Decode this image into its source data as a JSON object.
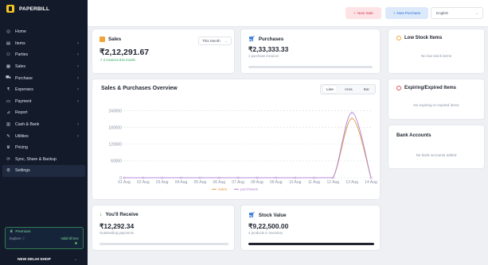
{
  "app": {
    "name": "PAPERBILL"
  },
  "sidebar": {
    "items": [
      {
        "label": "Home",
        "icon": "home-icon",
        "glyph": "◎",
        "chevron": false
      },
      {
        "label": "Items",
        "icon": "items-icon",
        "glyph": "▤",
        "chevron": true
      },
      {
        "label": "Parties",
        "icon": "users-icon",
        "glyph": "⚇",
        "chevron": true
      },
      {
        "label": "Sales",
        "icon": "sales-icon",
        "glyph": "▦",
        "chevron": true
      },
      {
        "label": "Purchase",
        "icon": "cart-icon",
        "glyph": "⛟",
        "chevron": true
      },
      {
        "label": "Expenses",
        "icon": "expenses-icon",
        "glyph": "₹",
        "chevron": true
      },
      {
        "label": "Payment",
        "icon": "payment-icon",
        "glyph": "▭",
        "chevron": true
      },
      {
        "label": "Report",
        "icon": "report-icon",
        "glyph": "⊿",
        "chevron": false
      },
      {
        "label": "Cash & Bank",
        "icon": "bank-icon",
        "glyph": "▥",
        "chevron": true
      },
      {
        "label": "Utilities",
        "icon": "utilities-icon",
        "glyph": "✎",
        "chevron": true
      },
      {
        "label": "Pricing",
        "icon": "pricing-icon",
        "glyph": "♛",
        "chevron": false
      },
      {
        "label": "Sync, Share & Backup",
        "icon": "sync-icon",
        "glyph": "⟳",
        "chevron": false
      },
      {
        "label": "Settings",
        "icon": "gear-icon",
        "glyph": "⚙",
        "chevron": false,
        "active": true
      }
    ],
    "premium": {
      "title": "Premium",
      "plan": "Explore ⓘ",
      "status": "Valid till Dec"
    },
    "shop": {
      "name": "NEW DELHI SHOP"
    }
  },
  "topbar": {
    "new_sale": "New Sale",
    "new_purchase": "New Purchase",
    "language": "English"
  },
  "sales": {
    "title": "Sales",
    "period": "This Month",
    "amount": "₹2,12,291.67",
    "trend": "2 invoices this month"
  },
  "purchases": {
    "title": "Purchases",
    "amount": "₹2,33,333.33",
    "sub": "1 purchase invoices"
  },
  "overview": {
    "title": "Sales & Purchases Overview",
    "toggles": [
      "Line",
      "Area",
      "Bar"
    ],
    "active_toggle": "Line"
  },
  "chart_data": {
    "type": "line",
    "title": "Sales & Purchases Overview",
    "x": [
      "01 Aug",
      "02 Aug",
      "03 Aug",
      "04 Aug",
      "05 Aug",
      "06 Aug",
      "07 Aug",
      "08 Aug",
      "09 Aug",
      "10 Aug",
      "11 Aug",
      "12 Aug",
      "13 Aug",
      "14 Aug"
    ],
    "yticks": [
      0,
      60000,
      120000,
      180000,
      240000
    ],
    "ylim": [
      0,
      250000
    ],
    "series": [
      {
        "name": "sales",
        "color": "#e3a14a",
        "values": [
          0,
          0,
          0,
          0,
          0,
          0,
          0,
          0,
          0,
          0,
          0,
          0,
          212292,
          0
        ]
      },
      {
        "name": "purchases",
        "color": "#b48ad8",
        "values": [
          0,
          0,
          0,
          0,
          0,
          0,
          0,
          0,
          0,
          0,
          0,
          0,
          233333,
          0
        ]
      }
    ],
    "grid": true,
    "legend": "bottom-center"
  },
  "low_stock": {
    "title": "Low Stock Items",
    "empty": "No low stock items"
  },
  "expiring": {
    "title": "Expiring/Expired Items",
    "empty": "No expiring or expired items"
  },
  "bank": {
    "title": "Bank Accounts",
    "empty": "No bank accounts added"
  },
  "receive": {
    "title": "You'll Receive",
    "amount": "₹12,292.34",
    "sub": "Outstanding payments"
  },
  "stock": {
    "title": "Stock Value",
    "amount": "₹9,22,500.00",
    "sub": "4 products in inventory"
  },
  "colors": {
    "sidebar": "#131a2a",
    "accent_red": "#d6374c",
    "accent_blue": "#2a6fd6",
    "green": "#2fa863"
  }
}
